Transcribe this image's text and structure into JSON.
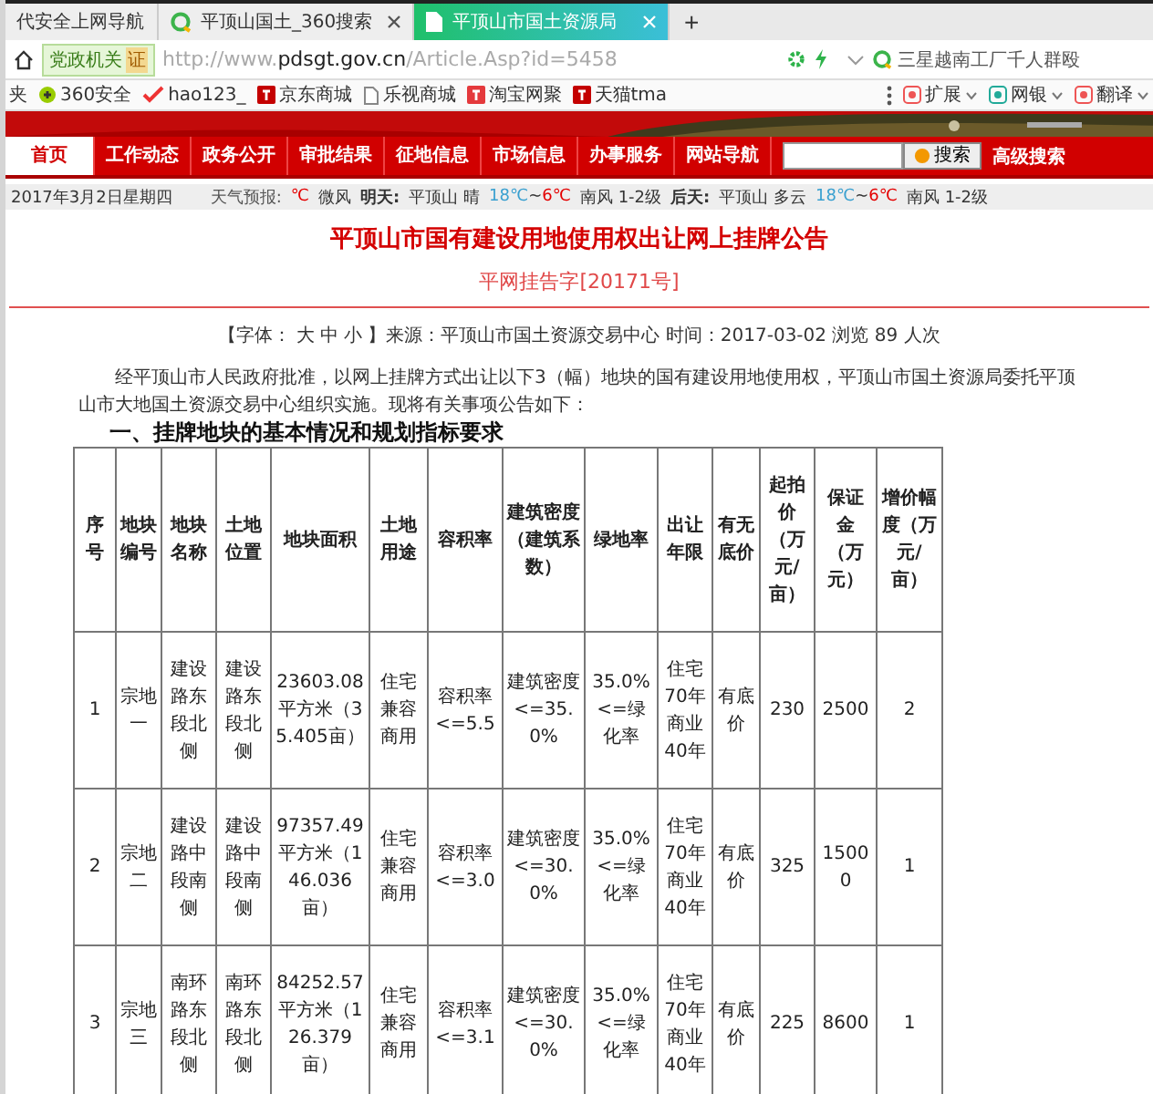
{
  "browser": {
    "tabs": [
      {
        "label": "代安全上网导航",
        "selected": false
      },
      {
        "label": "平顶山国土_360搜索",
        "selected": false
      },
      {
        "label": "平顶山市国土资源局",
        "selected": true
      }
    ],
    "new_tab": "+",
    "address": {
      "badge": "党政机关",
      "cert": "证",
      "scheme": "http://www.",
      "domain": "pdsgt.gov.cn",
      "path": "/Article.Asp?id=5458"
    },
    "search_box": {
      "value": "三星越南工厂千人群殴"
    },
    "bookmarks": [
      {
        "label": "夹"
      },
      {
        "label": "360安全"
      },
      {
        "label": "hao123_"
      },
      {
        "label": "京东商城"
      },
      {
        "label": "乐视商城"
      },
      {
        "label": "淘宝网聚"
      },
      {
        "label": "天猫tma"
      }
    ],
    "tools": [
      {
        "label": "扩展"
      },
      {
        "label": "网银"
      },
      {
        "label": "翻译"
      }
    ]
  },
  "site": {
    "nav": [
      {
        "label": "首页",
        "selected": true
      },
      {
        "label": "工作动态",
        "selected": false
      },
      {
        "label": "政务公开",
        "selected": false
      },
      {
        "label": "审批结果",
        "selected": false
      },
      {
        "label": "征地信息",
        "selected": false
      },
      {
        "label": "市场信息",
        "selected": false
      },
      {
        "label": "办事服务",
        "selected": false
      },
      {
        "label": "网站导航",
        "selected": false
      }
    ],
    "search_button": "搜索",
    "advanced_search": "高级搜索",
    "date": "2017年3月2日星期四",
    "weather": {
      "label": "天气预报:",
      "today_temp": "℃",
      "today_wind": "微风",
      "days": [
        {
          "name": "明天:",
          "place": "平顶山 晴",
          "temp_high": "18℃",
          "sep": "~",
          "temp_low": "6℃",
          "wind": "南风 1-2级"
        },
        {
          "name": "后天:",
          "place": "平顶山 多云",
          "temp_high": "18℃",
          "sep": "~",
          "temp_low": "6℃",
          "wind": "南风 1-2级"
        }
      ]
    }
  },
  "article": {
    "title": "平顶山市国有建设用地使用权出让网上挂牌公告",
    "subtitle": "平网挂告字[20171号]",
    "meta": {
      "font_label": "【字体：",
      "sizes": [
        "大",
        "中",
        "小"
      ],
      "rest": "】来源：平顶山市国土资源交易中心 时间：2017-03-02 浏览 89 人次"
    },
    "intro": "经平顶山市人民政府批准，以网上挂牌方式出让以下3（幅）地块的国有建设用地使用权，平顶山市国土资源局委托平顶山市大地国土资源交易中心组织实施。现将有关事项公告如下：",
    "section": "一、挂牌地块的基本情况和规划指标要求",
    "table": {
      "columns": [
        "序号",
        "地块编号",
        "地块名称",
        "土地位置",
        "地块面积",
        "土地用途",
        "容积率",
        "建筑密度（建筑系数）",
        "绿地率",
        "出让年限",
        "有无底价",
        "起拍价（万元/亩）",
        "保证金（万元）",
        "增价幅度（万元/亩）"
      ],
      "rows": [
        [
          "1",
          "宗地一",
          "建设路东段北侧",
          "建设路东段北侧",
          "23603.08平方米（35.405亩）",
          "住宅兼容商用",
          "容积率<=5.5",
          "建筑密度<=35.0%",
          "35.0%<=绿化率",
          "住宅70年商业40年",
          "有底价",
          "230",
          "2500",
          "2"
        ],
        [
          "2",
          "宗地二",
          "建设路中段南侧",
          "建设路中段南侧",
          "97357.49平方米（146.036亩）",
          "住宅兼容商用",
          "容积率<=3.0",
          "建筑密度<=30.0%",
          "35.0%<=绿化率",
          "住宅70年商业40年",
          "有底价",
          "325",
          "15000",
          "1"
        ],
        [
          "3",
          "宗地三",
          "南环路东段北侧",
          "南环路东段北侧",
          "84252.57平方米（126.379亩）",
          "住宅兼容商用",
          "容积率<=3.1",
          "建筑密度<=30.0%",
          "35.0%<=绿化率",
          "住宅70年商业40年",
          "有底价",
          "225",
          "8600",
          "1"
        ]
      ]
    }
  }
}
